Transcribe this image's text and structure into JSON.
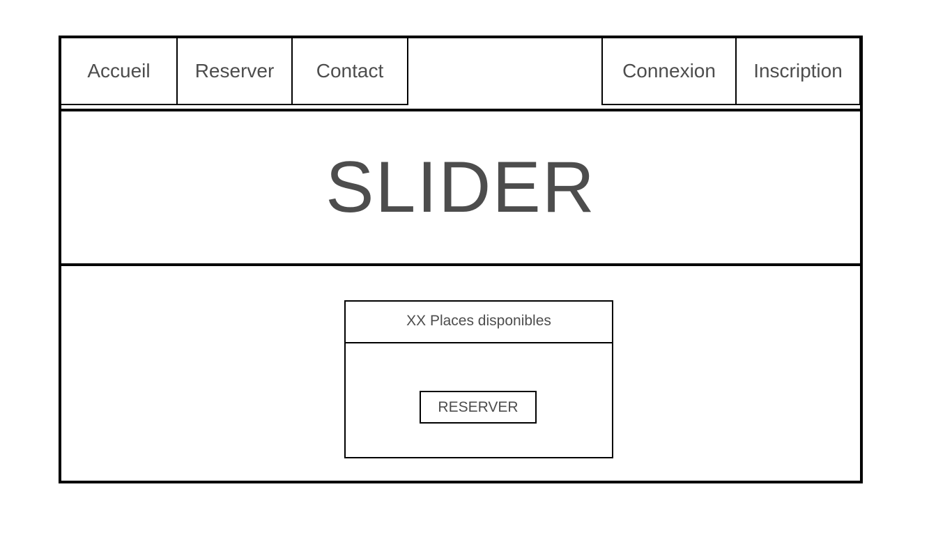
{
  "nav": {
    "accueil": "Accueil",
    "reserver": "Reserver",
    "contact": "Contact",
    "connexion": "Connexion",
    "inscription": "Inscription"
  },
  "slider": {
    "label": "SLIDER"
  },
  "availability": {
    "places_text": "XX Places disponibles",
    "reserve_button": "RESERVER"
  }
}
